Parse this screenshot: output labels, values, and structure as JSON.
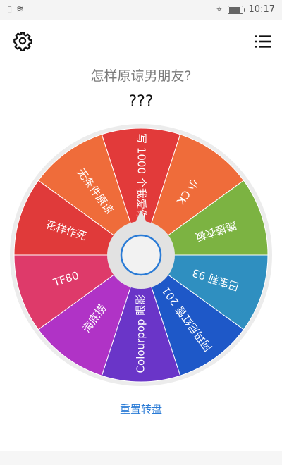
{
  "status": {
    "time": "10:17"
  },
  "header": {
    "question": "怎样原谅男朋友?",
    "result": "???"
  },
  "wheel": {
    "segments": [
      {
        "label": "无条件原谅",
        "color": "#ef6c3a"
      },
      {
        "label": "写 1000 个我爱你",
        "color": "#e23a3a"
      },
      {
        "label": "小 CK",
        "color": "#ef6c3a"
      },
      {
        "label": "跪搓衣板",
        "color": "#7cb342"
      },
      {
        "label": "巴宝莉 93",
        "color": "#2f8fc0"
      },
      {
        "label": "阿玛尼红管 201",
        "color": "#1e58c8"
      },
      {
        "label": "Colourpop 眼影",
        "color": "#6a35c8"
      },
      {
        "label": "海底捞",
        "color": "#b033c6"
      },
      {
        "label": "TF80",
        "color": "#de3a6a"
      },
      {
        "label": "花样作死",
        "color": "#e03a3a"
      }
    ]
  },
  "footer": {
    "reset_label": "重置转盘"
  }
}
